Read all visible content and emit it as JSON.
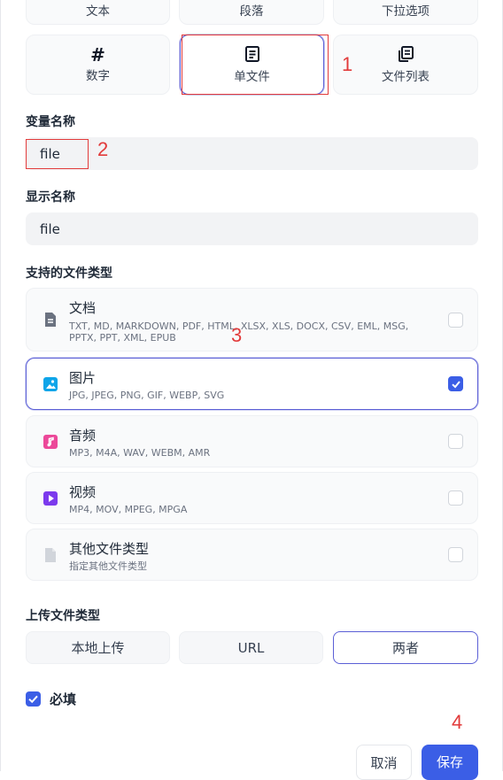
{
  "field_types": {
    "row1": [
      {
        "label": "文本"
      },
      {
        "label": "段落"
      },
      {
        "label": "下拉选项"
      }
    ],
    "row2": [
      {
        "label": "数字",
        "icon": "hash-icon"
      },
      {
        "label": "单文件",
        "icon": "document-icon",
        "selected": true
      },
      {
        "label": "文件列表",
        "icon": "file-list-icon"
      }
    ]
  },
  "variable_name": {
    "label": "变量名称",
    "value": "file"
  },
  "display_name": {
    "label": "显示名称",
    "value": "file"
  },
  "supported_types": {
    "label": "支持的文件类型",
    "items": [
      {
        "name": "文档",
        "desc": "TXT, MD, MARKDOWN, PDF, HTML, XLSX, XLS, DOCX, CSV, EML, MSG, PPTX, PPT, XML, EPUB",
        "checked": false,
        "icon": "document-file-icon",
        "color": "#6b7280"
      },
      {
        "name": "图片",
        "desc": "JPG, JPEG, PNG, GIF, WEBP, SVG",
        "checked": true,
        "icon": "image-file-icon",
        "color": "#0ea5e9"
      },
      {
        "name": "音频",
        "desc": "MP3, M4A, WAV, WEBM, AMR",
        "checked": false,
        "icon": "audio-file-icon",
        "color": "#ec4899"
      },
      {
        "name": "视频",
        "desc": "MP4, MOV, MPEG, MPGA",
        "checked": false,
        "icon": "video-file-icon",
        "color": "#7c3aed"
      },
      {
        "name": "其他文件类型",
        "desc": "指定其他文件类型",
        "checked": false,
        "icon": "other-file-icon",
        "color": "#d1d5db"
      }
    ]
  },
  "upload_type": {
    "label": "上传文件类型",
    "options": [
      "本地上传",
      "URL",
      "两者"
    ],
    "selected": "两者"
  },
  "required": {
    "label": "必填",
    "checked": true
  },
  "actions": {
    "cancel": "取消",
    "save": "保存"
  },
  "annotations": [
    "1",
    "2",
    "3",
    "4"
  ],
  "colors": {
    "accent": "#3b5ee6",
    "selected_border": "#5b5fd6",
    "annotation": "#e23b3b"
  }
}
